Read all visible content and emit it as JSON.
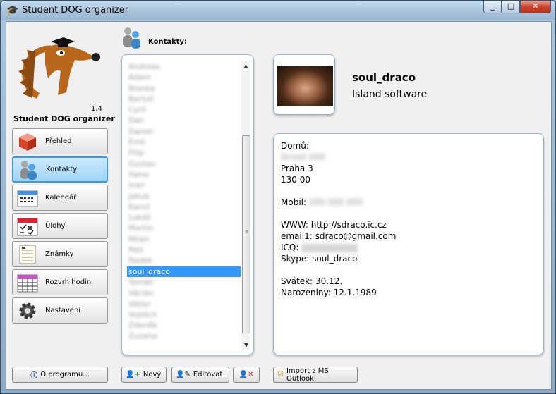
{
  "window": {
    "title": "Student DOG organizer",
    "buttons": {
      "minimize": "_",
      "maximize": "□",
      "close": "✕"
    }
  },
  "app": {
    "version": "1.4",
    "name": "Student DOG organizer"
  },
  "nav": {
    "items": [
      {
        "label": "Přehled",
        "icon": "cube-icon"
      },
      {
        "label": "Kontakty",
        "icon": "contacts-icon",
        "active": true
      },
      {
        "label": "Kalendář",
        "icon": "calendar-icon"
      },
      {
        "label": "Úlohy",
        "icon": "tasks-icon"
      },
      {
        "label": "Známky",
        "icon": "grades-icon"
      },
      {
        "label": "Rozvrh hodin",
        "icon": "timetable-icon"
      },
      {
        "label": "Nastavení",
        "icon": "gear-icon"
      }
    ],
    "about_label": "O programu..."
  },
  "contacts": {
    "title": "Kontakty:",
    "list": [
      "Andreas",
      "Adam",
      "Blanka",
      "Bartoš",
      "Cyril",
      "Dan",
      "Daniel",
      "Emil",
      "Filip",
      "Gustav",
      "Hana",
      "Ivan",
      "Jakub",
      "Kamil",
      "Lukáš",
      "Martin",
      "Milan",
      "Petr",
      "Radek",
      "soul_draco",
      "Tomáš",
      "Václav",
      "Viktor",
      "Vojtěch",
      "Zdeněk",
      "Zuzana"
    ],
    "selected_index": 19
  },
  "profile": {
    "name": "soul_draco",
    "company": "Island software",
    "home_label": "Domů:",
    "street": "Street 000",
    "city": "Praha 3",
    "zip": "130 00",
    "mobile_label": "Mobil:",
    "mobile_value": "000 000 000",
    "www": "WWW: http://sdraco.ic.cz",
    "email": "email1: sdraco@gmail.com",
    "icq_label": "ICQ:",
    "skype": "Skype: soul_draco",
    "svatek": "Svátek: 30.12.",
    "narozeniny": "Narozeniny: 12.1.1989"
  },
  "toolbar": {
    "new_label": "Nový",
    "edit_label": "Editovat",
    "import_label": "Import z MS Outlook"
  }
}
